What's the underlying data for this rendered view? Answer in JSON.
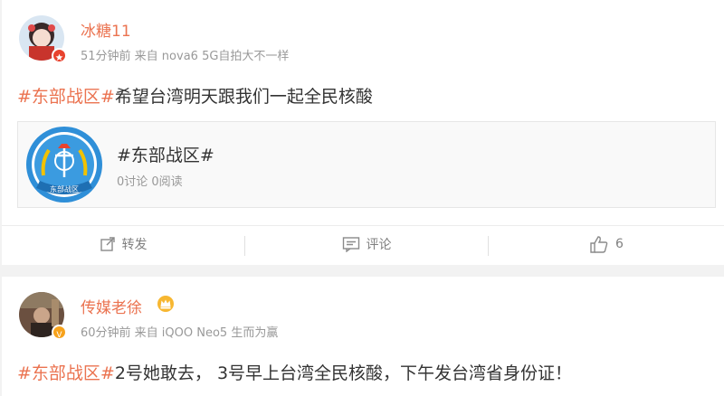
{
  "posts": [
    {
      "username": "冰糖11",
      "meta": "51分钟前 来自 nova6 5G自拍大不一样",
      "topic": "#东部战区#",
      "text": "希望台湾明天跟我们一起全民核酸",
      "link_card": {
        "title": "#东部战区#",
        "subtitle": "0讨论 0阅读",
        "logo_text": "东部战区"
      },
      "actions": {
        "repost": "转发",
        "comment": "评论",
        "like_count": "6"
      }
    },
    {
      "username": "传媒老徐",
      "meta": "60分钟前 来自 iQOO Neo5 生而为赢",
      "topic": "#东部战区#",
      "text": "2号她敢去， 3号早上台湾全民核酸，下午发台湾省身份证！"
    }
  ],
  "colors": {
    "accent": "#eb7350",
    "link_blue": "#507daf",
    "muted": "#999999"
  }
}
